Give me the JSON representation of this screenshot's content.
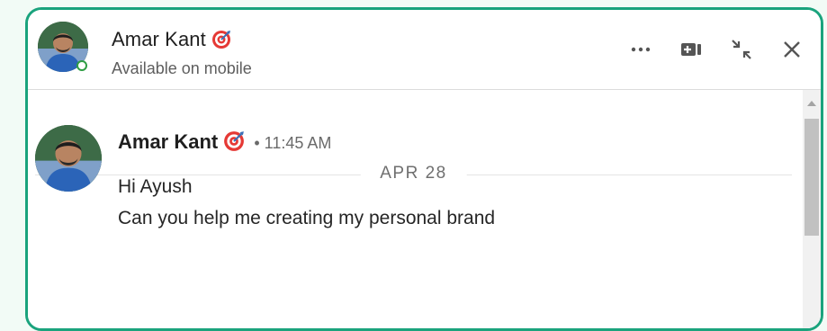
{
  "contact": {
    "name": "Amar Kant",
    "status": "Available on mobile"
  },
  "header_actions": [
    {
      "icon": "more-icon"
    },
    {
      "icon": "video-call-icon"
    },
    {
      "icon": "minimize-icon"
    },
    {
      "icon": "close-icon"
    }
  ],
  "conversation": {
    "date_separator": "APR 28",
    "messages": [
      {
        "sender": "Amar Kant",
        "time": "• 11:45 AM",
        "lines": [
          "Hi Ayush",
          "Can you help me creating my personal brand"
        ]
      }
    ]
  },
  "colors": {
    "frame_border": "#1aa37d",
    "online": "#2f9e44",
    "target_badge": "#e53935"
  }
}
